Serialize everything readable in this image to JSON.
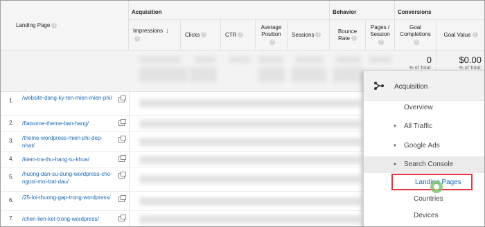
{
  "header": {
    "landing_page": "Landing Page",
    "acquisition": "Acquisition",
    "behavior": "Behavior",
    "conversions": "Conversions",
    "columns": {
      "impressions": "Impressions",
      "clicks": "Clicks",
      "ctr": "CTR",
      "avg_position_1": "Average",
      "avg_position_2": "Position",
      "sessions": "Sessions",
      "bounce_1": "Bounce",
      "bounce_2": "Rate",
      "pages_1": "Pages /",
      "pages_2": "Session",
      "goal_comp_1": "Goal",
      "goal_comp_2": "Completions",
      "goal_value": "Goal Value"
    }
  },
  "totals": {
    "goal_completions": "0",
    "goal_completions_sub_1": "% of Total:",
    "goal_value": "$0.00",
    "goal_value_sub_1": "% of Total:"
  },
  "rows": [
    {
      "index": "1.",
      "url": "/website-dang-ky-ten-mien-mien-phi/"
    },
    {
      "index": "2.",
      "url": "/flatsome-theme-ban-hang/"
    },
    {
      "index": "3.",
      "url": "/theme-wordpress-mien-phi-dep-nhat/"
    },
    {
      "index": "4.",
      "url": "/kiem-tra-thu-hang-tu-khoa/"
    },
    {
      "index": "5.",
      "url": "/huong-dan-su-dung-wordpress-cho-nguoi-moi-bat-dau/"
    },
    {
      "index": "6.",
      "url": "/25-loi-thuong-gap-trong-wordpress/"
    },
    {
      "index": "7.",
      "url": "/chen-lien-ket-trong-wordpress/"
    }
  ],
  "panel": {
    "acquisition": "Acquisition",
    "overview": "Overview",
    "all_traffic": "All Traffic",
    "google_ads": "Google Ads",
    "search_console": "Search Console",
    "landing_pages": "Landing Pages",
    "countries": "Countries",
    "devices": "Devices"
  },
  "icons": {
    "help": "question-icon",
    "sort": "sort-down-arrow-icon",
    "ext": "open-in-new-window-icon",
    "acquisition": "acquisition-icon",
    "expand": "triangle-right-icon",
    "collapse": "triangle-down-icon"
  },
  "colors": {
    "link": "#1a67b5",
    "highlight_border": "#e0383e",
    "header_bg": "#f5f5f5"
  }
}
